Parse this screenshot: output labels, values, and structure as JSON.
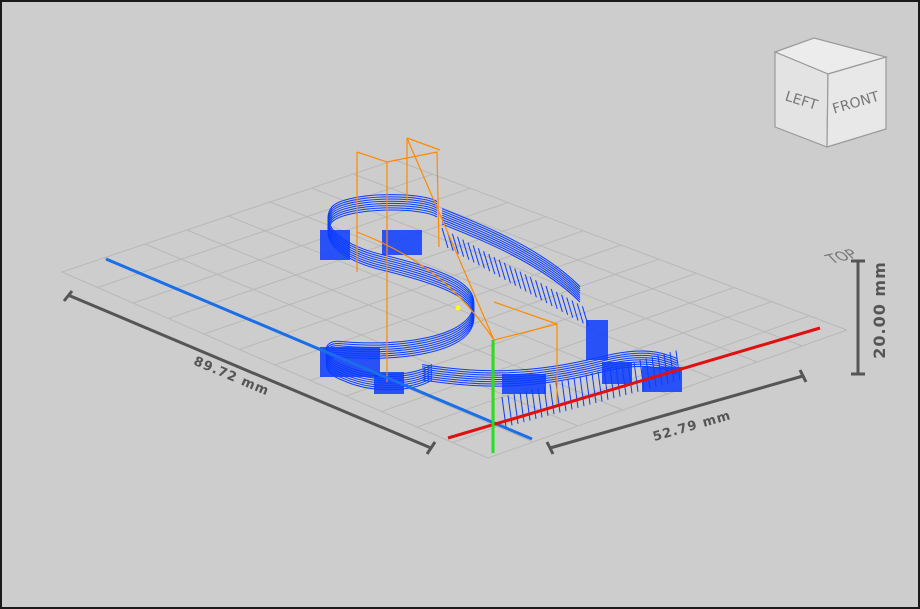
{
  "viewport": {
    "background": "#cdcdcd",
    "border_color": "#1a1a1a"
  },
  "dimensions": {
    "length_label": "89.72 mm",
    "width_label": "52.79 mm",
    "height_label": "20.00 mm",
    "color": "#555555"
  },
  "view_cube": {
    "top_label": "TOP",
    "left_label": "LEFT",
    "front_label": "FRONT"
  },
  "axes": {
    "x_color": "#e01010",
    "y_color": "#1a6ee8",
    "z_color": "#22e022"
  },
  "toolpath": {
    "path_color": "#0a3cff",
    "travel_color": "#ff8a00",
    "cursor_color": "#ffff00",
    "object_icon": "dollar-sign-icon"
  },
  "grid": {
    "visible": true,
    "color": "#b8b8b8"
  }
}
